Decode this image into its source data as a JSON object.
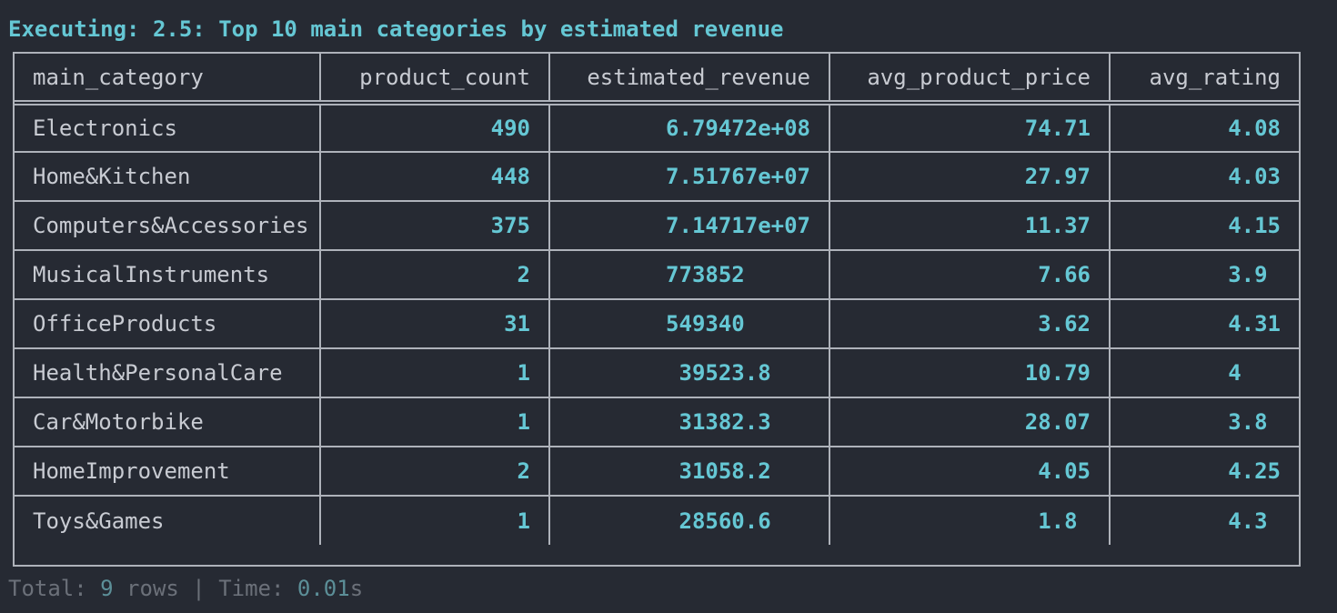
{
  "header": {
    "executing_line": "Executing: 2.5: Top 10 main categories by estimated revenue"
  },
  "table": {
    "columns": [
      "main_category",
      "product_count",
      "estimated_revenue",
      "avg_product_price",
      "avg_rating"
    ],
    "rows": [
      {
        "main_category": "Electronics",
        "product_count": "490",
        "estimated_revenue": "6.79472e+08",
        "avg_product_price": "74.71",
        "avg_rating": "4.08"
      },
      {
        "main_category": "Home&Kitchen",
        "product_count": "448",
        "estimated_revenue": "7.51767e+07",
        "avg_product_price": "27.97",
        "avg_rating": "4.03"
      },
      {
        "main_category": "Computers&Accessories",
        "product_count": "375",
        "estimated_revenue": "7.14717e+07",
        "avg_product_price": "11.37",
        "avg_rating": "4.15"
      },
      {
        "main_category": "MusicalInstruments",
        "product_count": "2",
        "estimated_revenue": "773852     ",
        "avg_product_price": "7.66",
        "avg_rating": "3.9 "
      },
      {
        "main_category": "OfficeProducts",
        "product_count": "31",
        "estimated_revenue": "549340     ",
        "avg_product_price": "3.62",
        "avg_rating": "4.31"
      },
      {
        "main_category": "Health&PersonalCare",
        "product_count": "1",
        "estimated_revenue": "39523.8   ",
        "avg_product_price": "10.79",
        "avg_rating": "4   "
      },
      {
        "main_category": "Car&Motorbike",
        "product_count": "1",
        "estimated_revenue": "31382.3   ",
        "avg_product_price": "28.07",
        "avg_rating": "3.8 "
      },
      {
        "main_category": "HomeImprovement",
        "product_count": "2",
        "estimated_revenue": "31058.2   ",
        "avg_product_price": "4.05",
        "avg_rating": "4.25"
      },
      {
        "main_category": "Toys&Games",
        "product_count": "1",
        "estimated_revenue": "28560.6   ",
        "avg_product_price": "1.8 ",
        "avg_rating": "4.3 "
      }
    ]
  },
  "footer": {
    "total_label": "Total: ",
    "row_count": "9",
    "rows_label": " rows | Time: ",
    "time_value": "0.01",
    "time_unit": "s"
  },
  "colors": {
    "background": "#262a33",
    "accent": "#65c7d4",
    "text": "#c8cbd2",
    "border": "#aeb2ba",
    "muted": "#6b7079"
  }
}
